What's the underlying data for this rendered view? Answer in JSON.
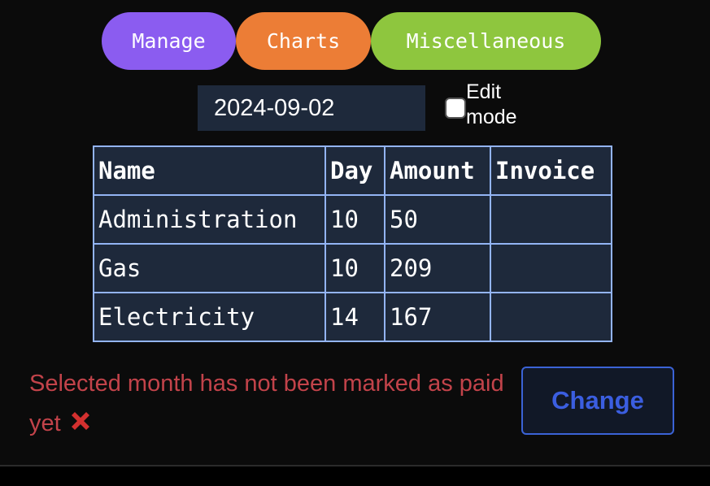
{
  "nav": {
    "manage_label": "Manage",
    "charts_label": "Charts",
    "misc_label": "Miscellaneous"
  },
  "controls": {
    "date_value": "2024-09-02",
    "edit_mode_label": "Edit mode",
    "edit_mode_checked": false
  },
  "table": {
    "headers": [
      "Name",
      "Day",
      "Amount",
      "Invoice"
    ],
    "rows": [
      [
        "Administration",
        "10",
        "50",
        ""
      ],
      [
        "Gas",
        "10",
        "209",
        ""
      ],
      [
        "Electricity",
        "14",
        "167",
        ""
      ]
    ]
  },
  "status": {
    "message": "Selected month has not been marked as paid yet",
    "icon": "cross-mark-icon"
  },
  "actions": {
    "change_label": "Change"
  },
  "colors": {
    "manage": "#8b5cf0",
    "charts": "#ec7d36",
    "misc": "#8ec63e",
    "status_text": "#c2434a",
    "table_border": "#93b4f4",
    "change_button": "#3b5ee0"
  }
}
